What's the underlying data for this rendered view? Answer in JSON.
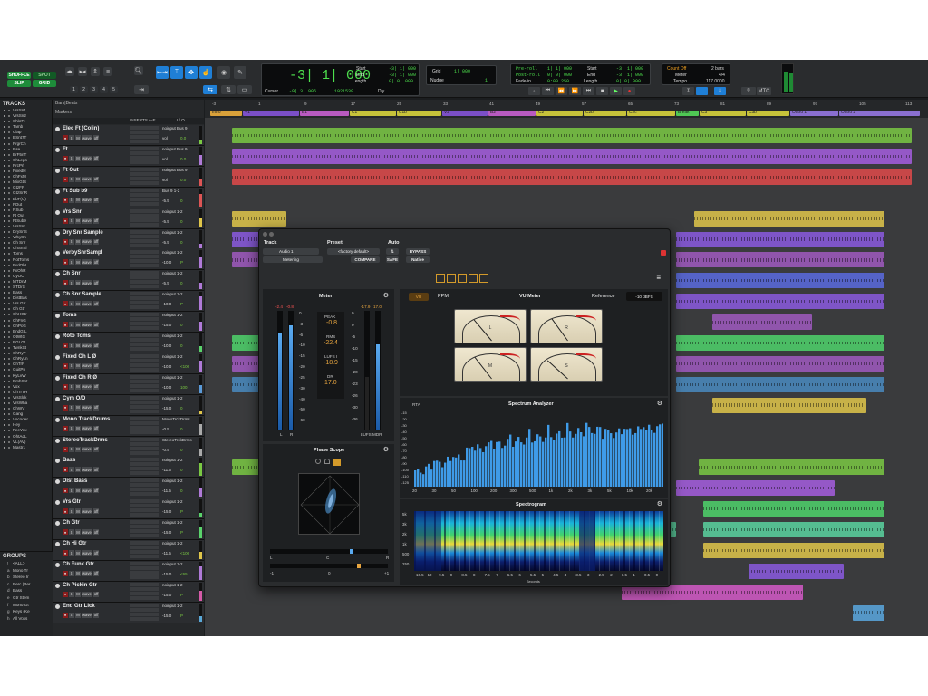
{
  "toolbar": {
    "modes": [
      "SHUFFLE",
      "SPOT",
      "SLIP",
      "GRID"
    ],
    "zoom_presets": [
      "1",
      "2",
      "3",
      "4",
      "5"
    ],
    "main_counter": "-3| 1| 000",
    "start": "Start",
    "end": "End",
    "length": "Length",
    "start_val": "-3| 1| 000",
    "end_val": "-3| 1| 000",
    "length_val": "0| 0| 000",
    "cursor_label": "Cursor",
    "cursor_val": "-9| 3| 906",
    "samples": "1921539",
    "dly": "Dly",
    "grid_label": "Grid",
    "grid_val": "1| 000",
    "nudge_label": "Nudge",
    "nudge_val": "1",
    "preroll": "Pre-roll",
    "postroll": "Post-roll",
    "fadein": "Fade-in",
    "preroll_val": "1| 1| 000",
    "postroll_val": "0| 0| 000",
    "fadein_val": "0:00.250",
    "t_start": "Start",
    "t_end": "End",
    "t_length": "Length",
    "t_start_val": "-3| 1| 000",
    "t_end_val": "-3| 1| 000",
    "t_length_val": "0| 0| 000",
    "countoff": "Count Off",
    "countoff_val": "2 bars",
    "meter": "Meter",
    "meter_val": "4/4",
    "tempo": "Tempo",
    "tempo_val": "117.0000",
    "mtc": "MTC"
  },
  "tracks_panel": {
    "title": "TRACKS",
    "items": [
      "VrsSn1",
      "VrsSn2",
      "ShkrFt",
      "Tamb",
      "Clap",
      "BSnt7T",
      "PrgrCh",
      "Rse",
      "BrF5nT",
      "ChLeps",
      "PrcPrl",
      "FixedH",
      "ChFxM",
      "MixGtS",
      "GtzFR",
      "GtzSnR",
      "EbF(C)",
      "FOut",
      "RSub",
      "Ft Out",
      "FtSub9",
      "VrsSnr",
      "DrySnS",
      "VrbySn",
      "Ch Snr",
      "ChSnSl",
      "Toms",
      "RotToms",
      "FxdOhL",
      "FxOhR",
      "CyOO",
      "MTDrM",
      "STDrS",
      "Bass",
      "DistBas",
      "Vrs Gtr",
      "Ch Gtr",
      "ChHGtr",
      "ChFnG",
      "ChPcG",
      "EndGtL",
      "OtWtG",
      "BGLGt",
      "TwnkSt",
      "ChRyP",
      "ChRyLn",
      "ChTrP",
      "GuitPn",
      "KyLvW",
      "EmbSnt",
      "Vox",
      "ChTrTH",
      "VrsSlck",
      "VrsWha",
      "ChWV",
      "Gang",
      "Vocoder",
      "Hey",
      "FeeVox",
      "OhtAdL",
      "VL(AV)",
      "Mastr1"
    ]
  },
  "groups_panel": {
    "title": "GROUPS",
    "items": [
      {
        "k": "!",
        "n": "<ALL>"
      },
      {
        "k": "a",
        "n": "Mono Tr"
      },
      {
        "k": "b",
        "n": "Stereo Ir"
      },
      {
        "k": "c",
        "n": "Perc (Per"
      },
      {
        "k": "d",
        "n": "Bass"
      },
      {
        "k": "e",
        "n": "Gtr Stem"
      },
      {
        "k": "f",
        "n": "Mono Gt"
      },
      {
        "k": "g",
        "n": "Keys (Ke"
      },
      {
        "k": "h",
        "n": "All Voxs"
      }
    ]
  },
  "tracklist": {
    "rulers": [
      "Bars|Beats",
      "Markers"
    ],
    "col_inserts": "INSERTS A-E",
    "col_io": "I / O"
  },
  "tracks": [
    {
      "name": "Elec Ft (Colin)",
      "io": "noinput Bus 9",
      "vol": "vol",
      "val": "0.0"
    },
    {
      "name": "Ft",
      "io": "noinput Bus 9",
      "vol": "vol",
      "val": "0.0"
    },
    {
      "name": "Ft Out",
      "io": "noinput Bus 9",
      "vol": "vol",
      "val": "0.0"
    },
    {
      "name": "Ft Sub b9",
      "io": "Bus 9 1-2",
      "vol": "-5.5",
      "val": "0"
    },
    {
      "name": "Vrs Snr",
      "io": "noinput 1-2",
      "vol": "-5.5",
      "val": "0"
    },
    {
      "name": "Dry Snr Sample",
      "io": "noinput 1-2",
      "vol": "-5.5",
      "val": "0"
    },
    {
      "name": "VerbySnrSampl",
      "io": "noinput 1-2",
      "vol": "-10.0",
      "val": "P"
    },
    {
      "name": "Ch Snr",
      "io": "noinput 1-2",
      "vol": "-5.5",
      "val": "0"
    },
    {
      "name": "Ch Snr Sample",
      "io": "noinput 1-2",
      "vol": "-10.0",
      "val": "P"
    },
    {
      "name": "Toms",
      "io": "noinput 1-2",
      "vol": "-15.0",
      "val": "0"
    },
    {
      "name": "Roto Toms",
      "io": "noinput 1-2",
      "vol": "-10.0",
      "val": "0"
    },
    {
      "name": "Fixed Oh L Ø",
      "io": "noinput 1-2",
      "vol": "-10.0",
      "val": "<100"
    },
    {
      "name": "Fixed Oh R Ø",
      "io": "noinput 1-2",
      "vol": "-10.0",
      "val": "100"
    },
    {
      "name": "Cym O/D",
      "io": "noinput 1-2",
      "vol": "-15.0",
      "val": "0"
    },
    {
      "name": "Mono TrackDrums",
      "io": "MonoTrckDrms",
      "vol": "-0.5",
      "val": "0"
    },
    {
      "name": "StereoTrackDrms",
      "io": "StereoTrckDrms",
      "vol": "-0.5",
      "val": "0"
    },
    {
      "name": "Bass",
      "io": "noinput 1-2",
      "vol": "-11.5",
      "val": "0"
    },
    {
      "name": "Dist Bass",
      "io": "noinput 1-2",
      "vol": "-11.5",
      "val": "0"
    },
    {
      "name": "Vrs Gtr",
      "io": "noinput 1-2",
      "vol": "-15.0",
      "val": "P"
    },
    {
      "name": "Ch Gtr",
      "io": "noinput 1-2",
      "vol": "-15.0",
      "val": "P"
    },
    {
      "name": "Ch Hi Gtr",
      "io": "noinput 1-2",
      "vol": "-11.5",
      "val": "<100"
    },
    {
      "name": "Ch Funk Gtr",
      "io": "noinput 1-2",
      "vol": "-15.0",
      "val": "<65"
    },
    {
      "name": "Ch Pickin Gtr",
      "io": "noinput 1-2",
      "vol": "-15.0",
      "val": "P"
    },
    {
      "name": "End Gtr Lick",
      "io": "noinput 1-2",
      "vol": "-15.0",
      "val": "P"
    }
  ],
  "bars": [
    "-3",
    "1",
    "9",
    "17",
    "25",
    "33",
    "41",
    "49",
    "57",
    "65",
    "73",
    "81",
    "89",
    "97",
    "105",
    "113"
  ],
  "markers": [
    {
      "t": "Intro",
      "c": "#d9a13a"
    },
    {
      "t": "V1",
      "c": "#7b4fc7"
    },
    {
      "t": "B1",
      "c": "#b85ac0"
    },
    {
      "t": "C1",
      "c": "#c7c23a"
    },
    {
      "t": "C1b",
      "c": "#c7c23a"
    },
    {
      "t": "V2",
      "c": "#7b4fc7"
    },
    {
      "t": "B2",
      "c": "#b85ac0"
    },
    {
      "t": "C2",
      "c": "#c7c23a"
    },
    {
      "t": "C2b",
      "c": "#c7c23a"
    },
    {
      "t": "C2c",
      "c": "#c7c23a"
    },
    {
      "t": "Break",
      "c": "#4fc754"
    },
    {
      "t": "C3",
      "c": "#c7c23a"
    },
    {
      "t": "C3b",
      "c": "#c7c23a"
    },
    {
      "t": "Outro 1",
      "c": "#8a6fd0"
    },
    {
      "t": "Outro 2",
      "c": "#8a6fd0"
    }
  ],
  "plugin": {
    "track_label": "Track",
    "preset_label": "Preset",
    "auto_label": "Auto",
    "track_name": "Audio 1",
    "insert_name": "Metering",
    "preset_name": "<factory default>",
    "compare": "COMPARE",
    "safe": "SAFE",
    "bypass": "BYPASS",
    "native": "Native",
    "meter": {
      "title": "Meter",
      "peak_l": "-2.4",
      "peak_r": "-0.8",
      "peak_label": "PEAK",
      "peak": "-0.8",
      "rms_label": "RMS",
      "rms": "-22.4",
      "lufs_label": "LUFS I",
      "lufs": "-18.9",
      "dr_label": "DR",
      "dr": "17.0",
      "lufs_peak": "-17.9",
      "lufs_max": "17.0",
      "l": "L",
      "r": "R",
      "lufs_mdr": "LUFS MDR",
      "scale": [
        "0",
        "-3",
        "-6",
        "-10",
        "-15",
        "-20",
        "-25",
        "-30",
        "-40",
        "-50",
        "-60"
      ],
      "lufs_scale": [
        "9",
        "0",
        "-5",
        "-10",
        "-15",
        "-20",
        "-23",
        "-26",
        "-30",
        "-36"
      ]
    },
    "vu": {
      "tab_vu": "VU",
      "tab_ppm": "PPM",
      "title": "VU Meter",
      "ref_label": "Reference",
      "ref_val": "-10 dBFS",
      "meters": [
        "L",
        "R",
        "M",
        "S"
      ]
    },
    "scope": {
      "title": "Phase Scope",
      "l": "L",
      "c": "C",
      "r": "R",
      "m1": "-1",
      "z": "0",
      "p1": "+1"
    },
    "rta": {
      "label": "RTA",
      "title": "Spectrum Analyzer",
      "y": [
        "-15",
        "-20",
        "-30",
        "-40",
        "-50",
        "-60",
        "-70",
        "-80",
        "-90",
        "-100",
        "-110",
        "-125"
      ],
      "x": [
        "20",
        "30",
        "50",
        "100",
        "200",
        "300",
        "500",
        "1k",
        "2k",
        "3k",
        "5k",
        "10k",
        "20k"
      ]
    },
    "spectro": {
      "title": "Spectrogram",
      "y": [
        "5k",
        "3k",
        "2k",
        "1k",
        "500",
        "250"
      ],
      "x": [
        "10.5",
        "10",
        "9.5",
        "9",
        "8.5",
        "8",
        "7.5",
        "7",
        "6.5",
        "6",
        "5.5",
        "5",
        "4.5",
        "4",
        "3.5",
        "3",
        "2.5",
        "2",
        "1.5",
        "1",
        "0.5",
        "0"
      ],
      "xlabel": "Seconds"
    }
  }
}
